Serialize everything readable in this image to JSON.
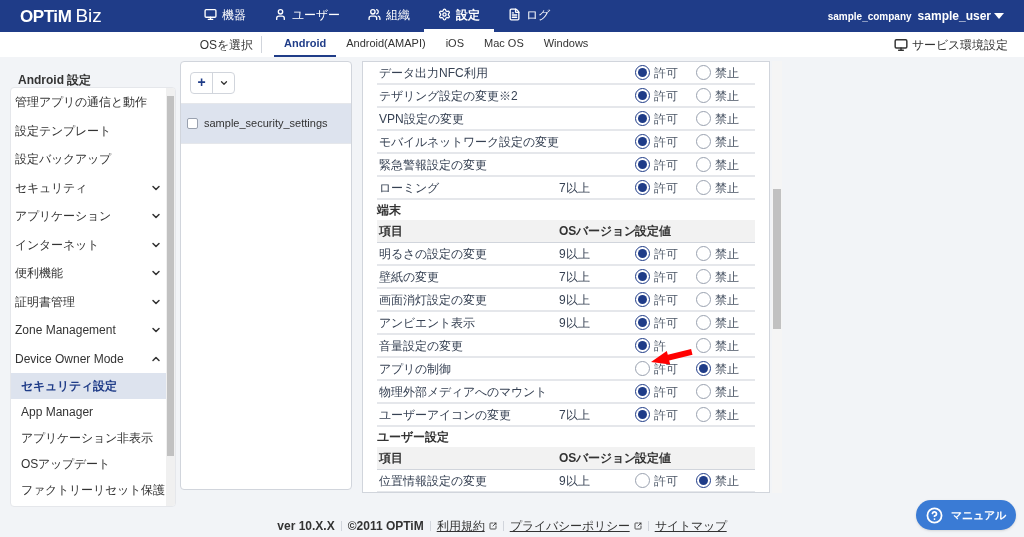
{
  "header": {
    "brand": "OPTiM",
    "product": "Biz",
    "nav": [
      {
        "label": "機器",
        "selected": false
      },
      {
        "label": "ユーザー",
        "selected": false
      },
      {
        "label": "組織",
        "selected": false
      },
      {
        "label": "設定",
        "selected": true
      },
      {
        "label": "ログ",
        "selected": false
      }
    ],
    "company": "sample_company",
    "user": "sample_user"
  },
  "subnav": {
    "label": "OSを選択",
    "tabs": [
      {
        "label": "Android",
        "selected": true
      },
      {
        "label": "Android(AMAPI)",
        "selected": false
      },
      {
        "label": "iOS",
        "selected": false
      },
      {
        "label": "Mac OS",
        "selected": false
      },
      {
        "label": "Windows",
        "selected": false
      }
    ],
    "service_link": "サービス環境設定"
  },
  "sidebar": {
    "title": "Android 設定",
    "items": [
      {
        "label": "管理アプリの通信と動作"
      },
      {
        "label": "設定テンプレート"
      },
      {
        "label": "設定バックアップ"
      },
      {
        "label": "セキュリティ",
        "expanded": false
      },
      {
        "label": "アプリケーション",
        "expanded": false
      },
      {
        "label": "インターネット",
        "expanded": false
      },
      {
        "label": "便利機能",
        "expanded": false
      },
      {
        "label": "証明書管理",
        "expanded": false
      },
      {
        "label": "Zone Management",
        "expanded": false
      },
      {
        "label": "Device Owner Mode",
        "expanded": true,
        "children": [
          {
            "label": "セキュリティ設定",
            "selected": true
          },
          {
            "label": "App Manager",
            "selected": false
          },
          {
            "label": "アプリケーション非表示",
            "selected": false
          },
          {
            "label": "OSアップデート",
            "selected": false
          },
          {
            "label": "ファクトリーリセット保護",
            "selected": false
          }
        ]
      }
    ]
  },
  "templates": {
    "add_button": "+",
    "items": [
      {
        "label": "sample_security_settings",
        "selected": true,
        "checked": false
      }
    ]
  },
  "sections": [
    {
      "rows": [
        {
          "item": "データ出力NFC利用",
          "options": [
            {
              "label": "許可",
              "selected": true
            },
            {
              "label": "禁止",
              "selected": false
            }
          ]
        },
        {
          "item": "テザリング設定の変更※2",
          "options": [
            {
              "label": "許可",
              "selected": true
            },
            {
              "label": "禁止",
              "selected": false
            }
          ]
        },
        {
          "item": "VPN設定の変更",
          "options": [
            {
              "label": "許可",
              "selected": true
            },
            {
              "label": "禁止",
              "selected": false
            }
          ]
        },
        {
          "item": "モバイルネットワーク設定の変更",
          "options": [
            {
              "label": "許可",
              "selected": true
            },
            {
              "label": "禁止",
              "selected": false
            }
          ]
        },
        {
          "item": "緊急警報設定の変更",
          "options": [
            {
              "label": "許可",
              "selected": true
            },
            {
              "label": "禁止",
              "selected": false
            }
          ]
        },
        {
          "item": "ローミング",
          "os": "7以上",
          "options": [
            {
              "label": "許可",
              "selected": true
            },
            {
              "label": "禁止",
              "selected": false
            }
          ]
        }
      ]
    },
    {
      "title": "端末",
      "columns": [
        "項目",
        "OSバージョン",
        "設定値"
      ],
      "rows": [
        {
          "item": "明るさの設定の変更",
          "os": "9以上",
          "options": [
            {
              "label": "許可",
              "selected": true
            },
            {
              "label": "禁止",
              "selected": false
            }
          ]
        },
        {
          "item": "壁紙の変更",
          "os": "7以上",
          "options": [
            {
              "label": "許可",
              "selected": true
            },
            {
              "label": "禁止",
              "selected": false
            }
          ]
        },
        {
          "item": "画面消灯設定の変更",
          "os": "9以上",
          "options": [
            {
              "label": "許可",
              "selected": true
            },
            {
              "label": "禁止",
              "selected": false
            }
          ]
        },
        {
          "item": "アンビエント表示",
          "os": "9以上",
          "options": [
            {
              "label": "許可",
              "selected": true
            },
            {
              "label": "禁止",
              "selected": false
            }
          ]
        },
        {
          "item": "音量設定の変更",
          "options": [
            {
              "label": "許",
              "selected": true
            },
            {
              "label": "禁止",
              "selected": false
            }
          ]
        },
        {
          "item": "アプリの制御",
          "options": [
            {
              "label": "許可",
              "selected": false
            },
            {
              "label": "禁止",
              "selected": true
            }
          ]
        },
        {
          "item": "物理外部メディアへのマウント",
          "options": [
            {
              "label": "許可",
              "selected": true
            },
            {
              "label": "禁止",
              "selected": false
            }
          ]
        },
        {
          "item": "ユーザーアイコンの変更",
          "os": "7以上",
          "options": [
            {
              "label": "許可",
              "selected": true
            },
            {
              "label": "禁止",
              "selected": false
            }
          ]
        }
      ]
    },
    {
      "title": "ユーザー設定",
      "columns": [
        "項目",
        "OSバージョン",
        "設定値"
      ],
      "rows": [
        {
          "item": "位置情報設定の変更",
          "os": "9以上",
          "options": [
            {
              "label": "許可",
              "selected": false
            },
            {
              "label": "禁止",
              "selected": true
            }
          ]
        }
      ]
    }
  ],
  "footer": [
    {
      "label": "ver 10.X.X",
      "kind": "text"
    },
    {
      "label": "©2011 OPTiM",
      "kind": "text"
    },
    {
      "label": "利用規約",
      "kind": "external"
    },
    {
      "label": "プライバシーポリシー",
      "kind": "external"
    },
    {
      "label": "サイトマップ",
      "kind": "link"
    }
  ],
  "manual_button": "マニュアル"
}
